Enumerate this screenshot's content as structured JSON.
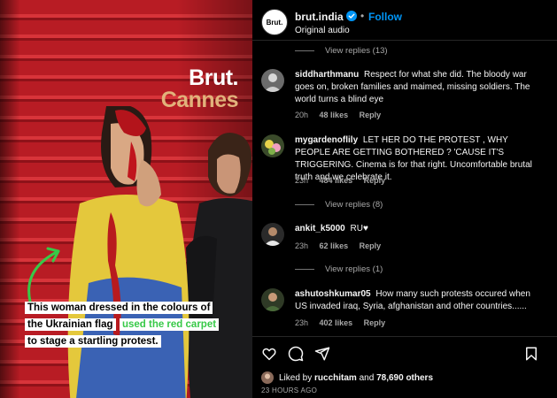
{
  "media": {
    "logo_line1": "Brut.",
    "logo_line2": "Cannes",
    "caption_part1": "This woman dressed in the colours of the Ukrainian flag",
    "caption_highlight": "used the red carpet",
    "caption_part2": "to stage a startling protest."
  },
  "header": {
    "avatar_text": "Brut.",
    "username": "brut.india",
    "separator": "•",
    "follow_label": "Follow",
    "subtitle": "Original audio"
  },
  "replies_13": "View replies (13)",
  "comments": [
    {
      "user": "siddharthmanu",
      "text": "Respect for what she did. The bloody war goes on, broken families and maimed, missing soldiers. The world turns a blind eye",
      "time": "20h",
      "likes": "48 likes",
      "reply": "Reply"
    },
    {
      "user": "mygardenoflily",
      "text": "LET HER DO THE PROTEST , WHY PEOPLE ARE GETTING BOTHERED ? 'CAUSE IT'S TRIGGERING. Cinema is for that right. Uncomfortable brutal truth and we celebrate it.",
      "time": "23h",
      "likes": "484 likes",
      "reply": "Reply",
      "view_replies": "View replies (8)"
    },
    {
      "user": "ankit_k5000",
      "text": "RU♥",
      "time": "23h",
      "likes": "62 likes",
      "reply": "Reply",
      "view_replies": "View replies (1)"
    },
    {
      "user": "ashutoshkumar05",
      "text": "How many such protests occured when US invaded iraq, Syria, afghanistan and other countries......",
      "time": "23h",
      "likes": "402 likes",
      "reply": "Reply"
    }
  ],
  "icons": {
    "like": "heart-icon",
    "comment": "comment-icon",
    "share": "share-icon",
    "save": "bookmark-icon",
    "verified": "verified-badge-icon"
  },
  "liked_by": {
    "prefix": "Liked by",
    "user": "rucchitam",
    "middle": "and",
    "others": "78,690 others"
  },
  "timestamp": "23 HOURS AGO",
  "colors": {
    "accent": "#0095f6",
    "background": "#000000",
    "muted": "#a8a8a8",
    "logo_gold": "#e2b27b",
    "caption_green": "#38c948"
  }
}
